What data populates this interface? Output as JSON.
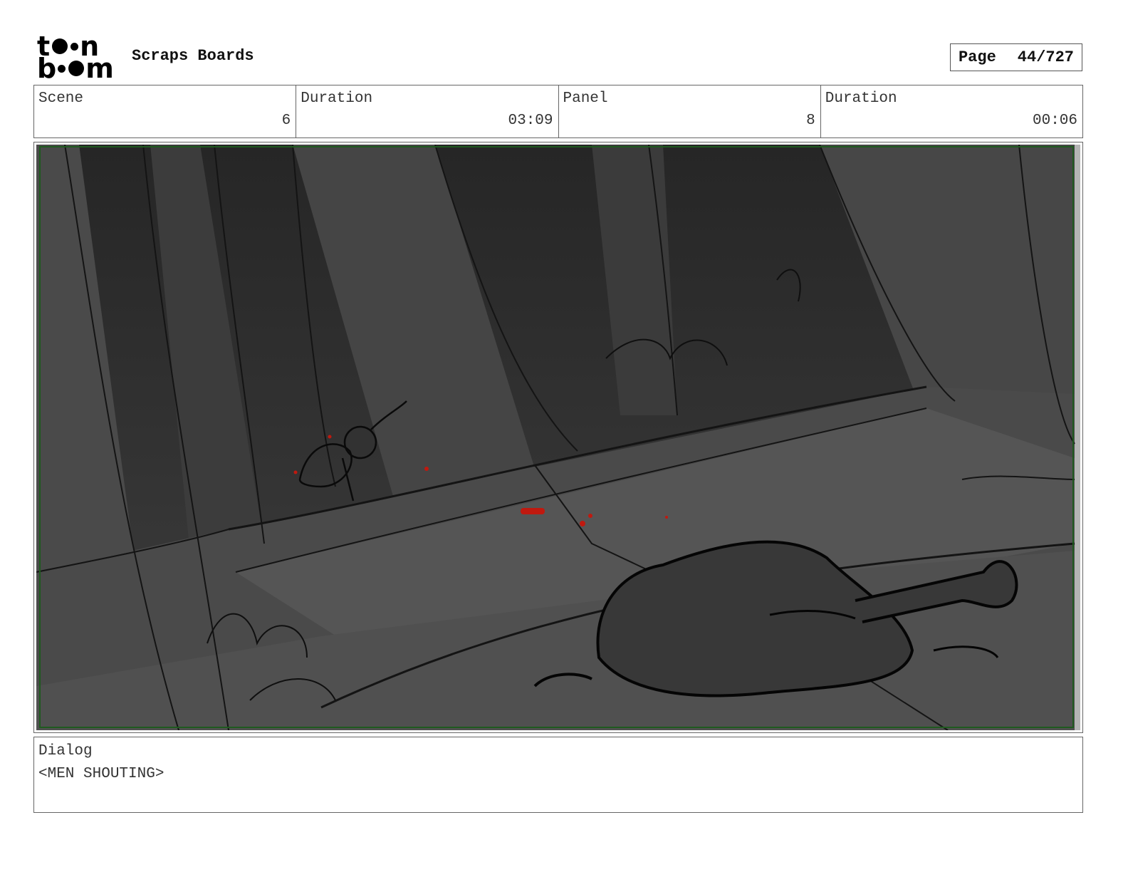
{
  "header": {
    "logo_text": "toonboom",
    "title": "Scraps Boards",
    "page_label": "Page",
    "page_value": "44/727"
  },
  "info": {
    "scene_label": "Scene",
    "scene_value": "6",
    "scene_duration_label": "Duration",
    "scene_duration_value": "03:09",
    "panel_label": "Panel",
    "panel_value": "8",
    "panel_duration_label": "Duration",
    "panel_duration_value": "00:06"
  },
  "panel": {
    "frame_color": "#1f5a1f",
    "accent_color": "#c0190f"
  },
  "dialog": {
    "label": "Dialog",
    "text": "<MEN SHOUTING>"
  }
}
